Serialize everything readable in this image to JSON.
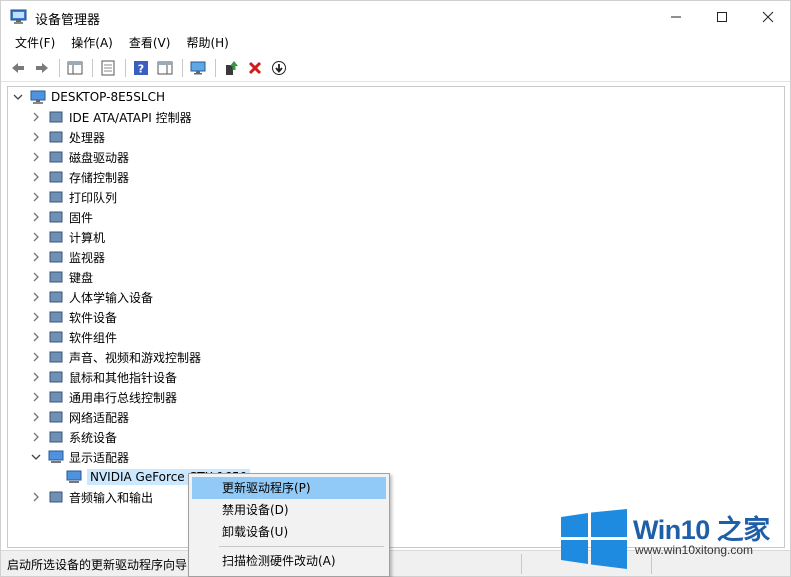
{
  "window": {
    "title": "设备管理器",
    "title_icon": "device-manager-icon"
  },
  "menu": [
    "文件(F)",
    "操作(A)",
    "查看(V)",
    "帮助(H)"
  ],
  "tree": {
    "root": "DESKTOP-8E5SLCH",
    "items": [
      {
        "label": "IDE ATA/ATAPI 控制器",
        "icon": "ide-controller-icon",
        "expanded": false
      },
      {
        "label": "处理器",
        "icon": "processor-icon",
        "expanded": false
      },
      {
        "label": "磁盘驱动器",
        "icon": "disk-drive-icon",
        "expanded": false
      },
      {
        "label": "存储控制器",
        "icon": "storage-controller-icon",
        "expanded": false
      },
      {
        "label": "打印队列",
        "icon": "printer-icon",
        "expanded": false
      },
      {
        "label": "固件",
        "icon": "firmware-icon",
        "expanded": false
      },
      {
        "label": "计算机",
        "icon": "computer-icon",
        "expanded": false
      },
      {
        "label": "监视器",
        "icon": "monitor-icon",
        "expanded": false
      },
      {
        "label": "键盘",
        "icon": "keyboard-icon",
        "expanded": false
      },
      {
        "label": "人体学输入设备",
        "icon": "hid-icon",
        "expanded": false
      },
      {
        "label": "软件设备",
        "icon": "software-device-icon",
        "expanded": false
      },
      {
        "label": "软件组件",
        "icon": "software-component-icon",
        "expanded": false
      },
      {
        "label": "声音、视频和游戏控制器",
        "icon": "sound-icon",
        "expanded": false
      },
      {
        "label": "鼠标和其他指针设备",
        "icon": "mouse-icon",
        "expanded": false
      },
      {
        "label": "通用串行总线控制器",
        "icon": "usb-icon",
        "expanded": false
      },
      {
        "label": "网络适配器",
        "icon": "network-adapter-icon",
        "expanded": false
      },
      {
        "label": "系统设备",
        "icon": "system-device-icon",
        "expanded": false
      },
      {
        "label": "显示适配器",
        "icon": "display-adapter-icon",
        "expanded": true
      },
      {
        "label": "音频输入和输出",
        "icon": "audio-io-icon",
        "expanded": false
      }
    ],
    "child": {
      "label": "NVIDIA GeForce GTX 1650",
      "icon": "gpu-icon"
    }
  },
  "context_menu": {
    "items": [
      "更新驱动程序(P)",
      "禁用设备(D)",
      "卸载设备(U)",
      "扫描检测硬件改动(A)"
    ],
    "highlighted": 0
  },
  "status": {
    "text": "启动所选设备的更新驱动程序向导"
  },
  "watermark": {
    "name": "Win10 之家",
    "url": "www.win10xitong.com"
  },
  "colors": {
    "selection": "#cce8ff",
    "menu_highlight": "#91c9f7",
    "watermark_blue": "#1f5fa8"
  }
}
